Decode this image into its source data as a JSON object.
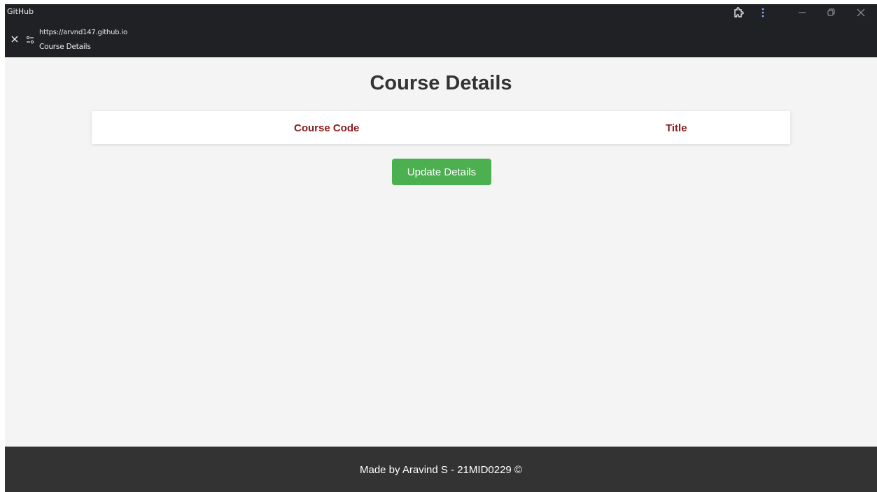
{
  "browser": {
    "app_name": "GitHub",
    "url": "https://arvnd147.github.io",
    "tab_title": "Course Details"
  },
  "page": {
    "title": "Course Details",
    "table": {
      "headers": [
        "Course Code",
        "Title"
      ]
    },
    "update_button_label": "Update Details"
  },
  "footer": {
    "text": "Made by Aravind S - 21MID0229 ©"
  },
  "colors": {
    "titlebar_bg": "#202124",
    "page_bg": "#f4f4f4",
    "header_text": "#8b1a1a",
    "button_bg": "#4caf50",
    "footer_bg": "#333333"
  },
  "icons": [
    "close-icon",
    "site-settings-icon",
    "extension-icon",
    "more-menu-icon",
    "minimize-icon",
    "restore-icon",
    "window-close-icon"
  ]
}
